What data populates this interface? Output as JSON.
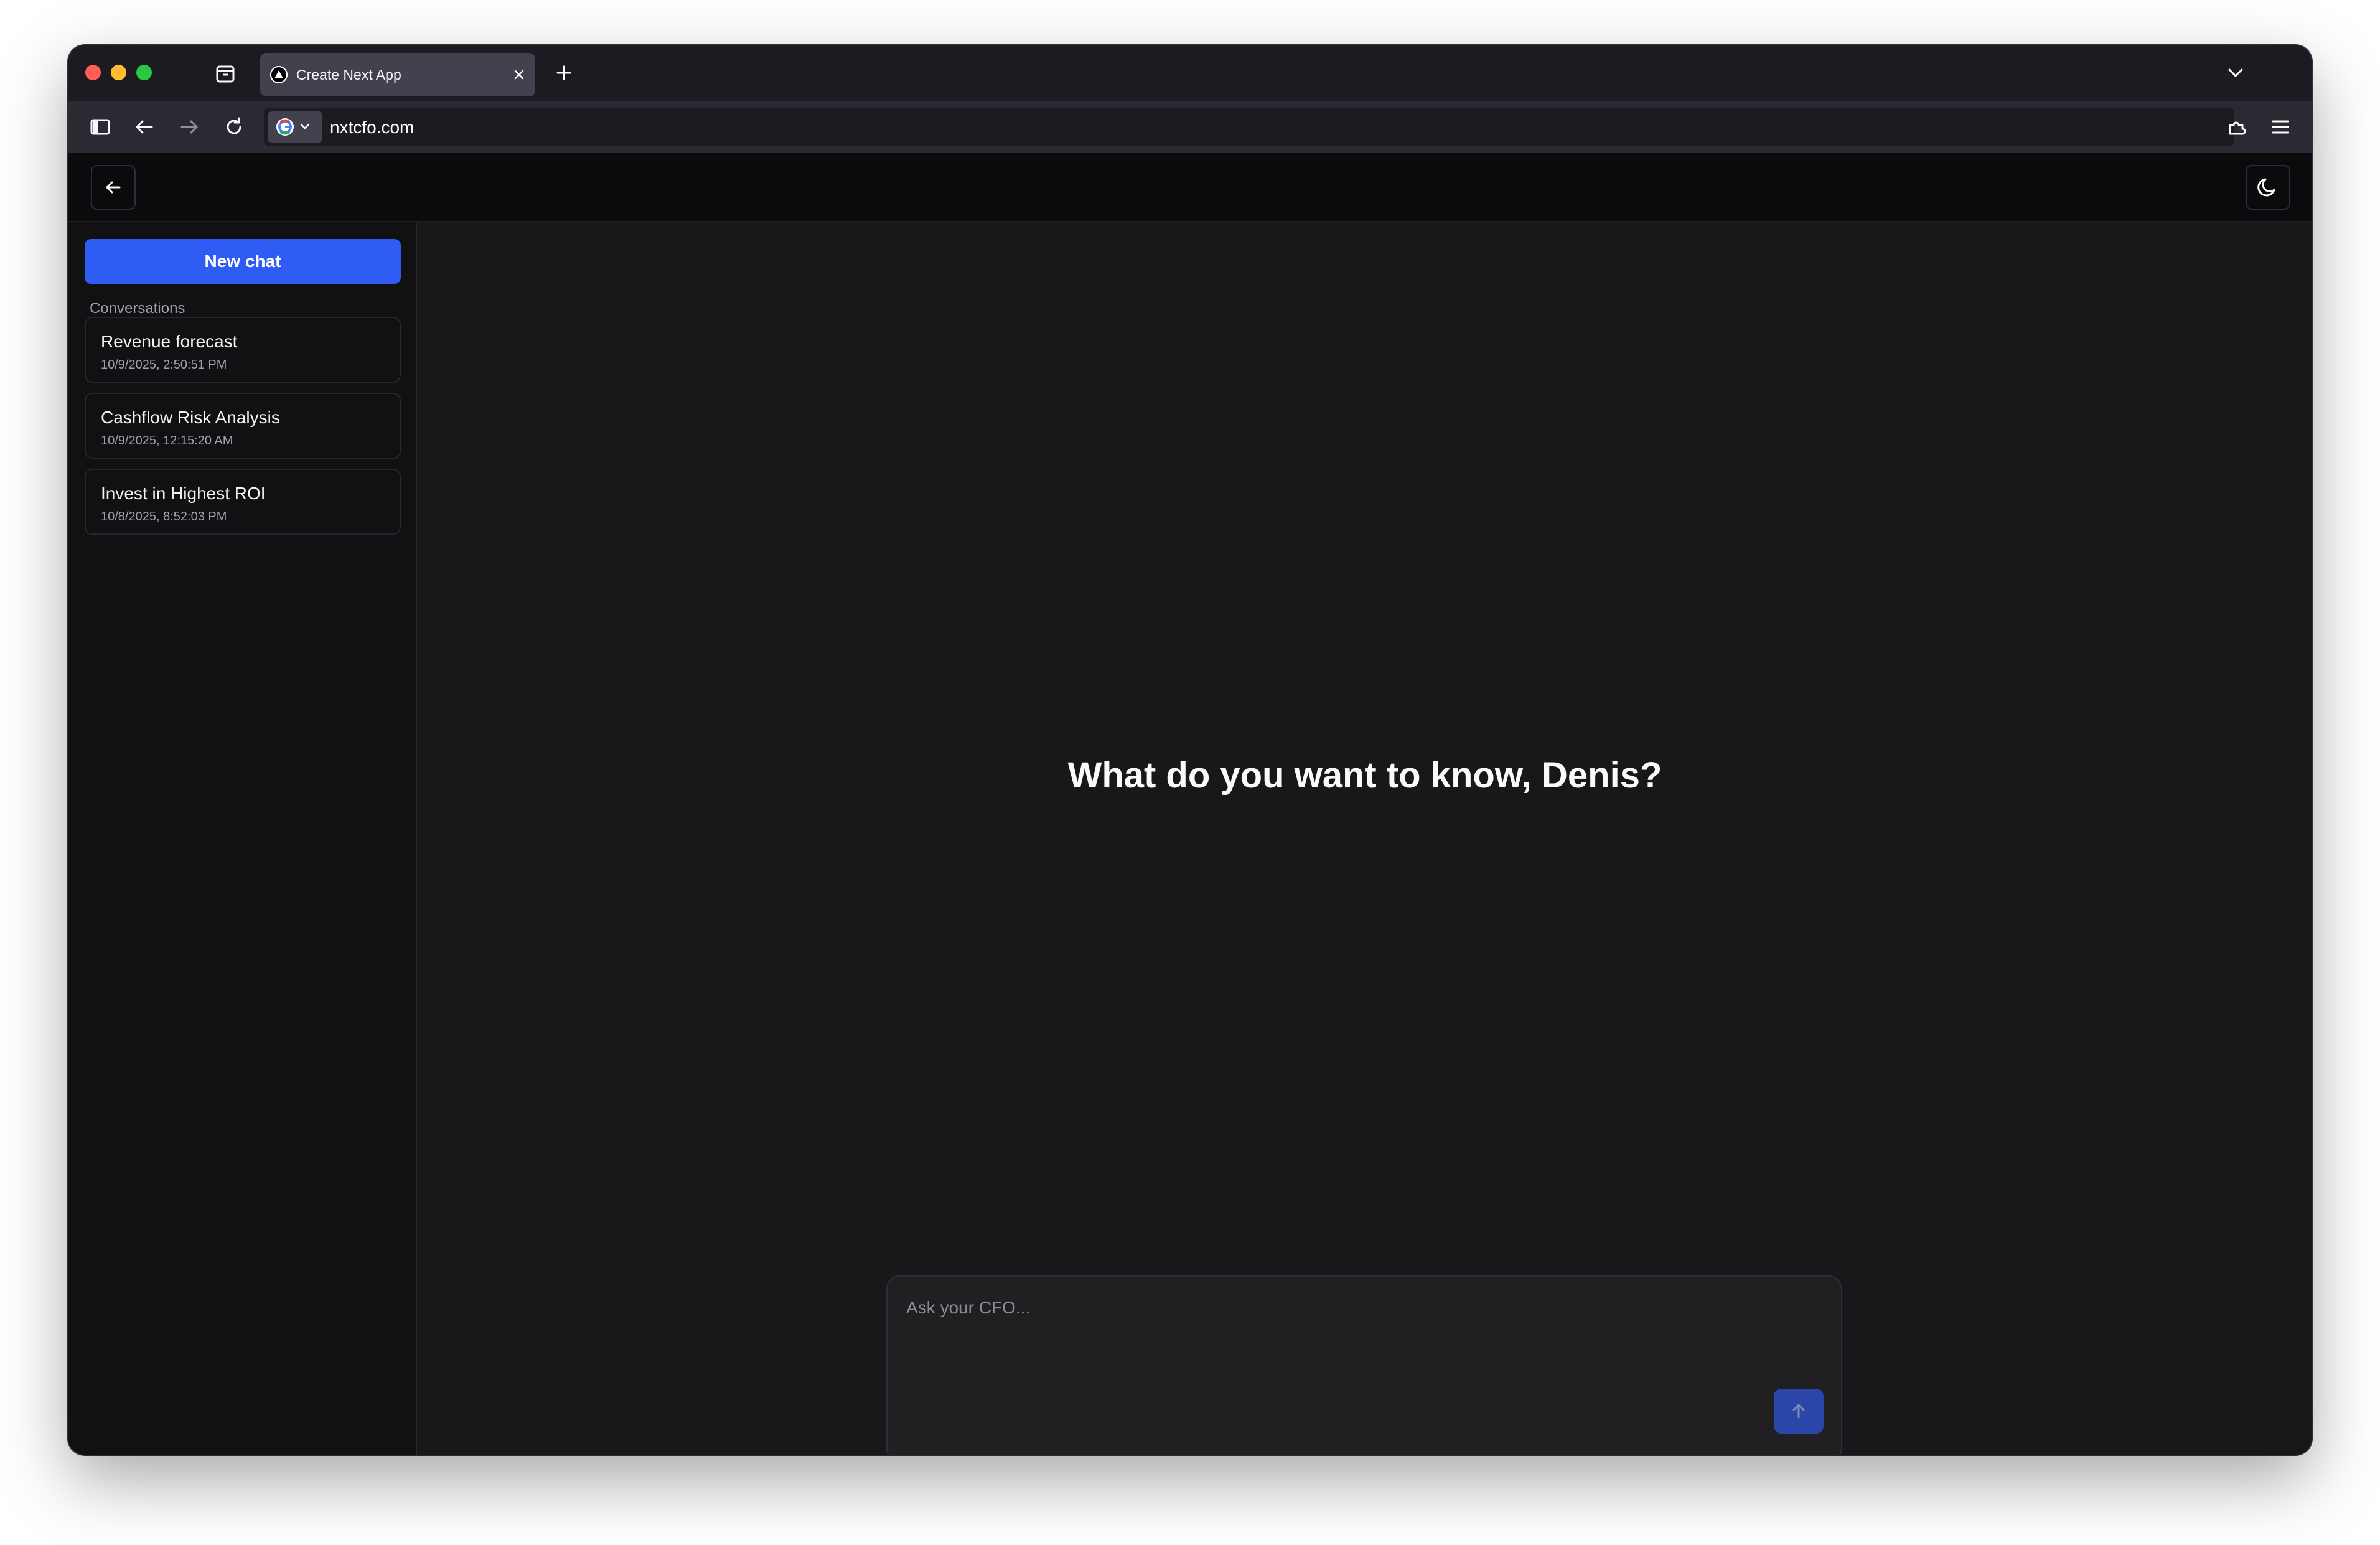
{
  "browser": {
    "tab_title": "Create Next App",
    "url": "nxtcfo.com"
  },
  "sidebar": {
    "new_chat_label": "New chat",
    "section_label": "Conversations",
    "conversations": [
      {
        "title": "Revenue forecast",
        "date": "10/9/2025, 2:50:51 PM"
      },
      {
        "title": "Cashflow Risk Analysis",
        "date": "10/9/2025, 12:15:20 AM"
      },
      {
        "title": "Invest in Highest ROI",
        "date": "10/8/2025, 8:52:03 PM"
      }
    ]
  },
  "main": {
    "greeting": "What do you want to know, Denis?",
    "composer_placeholder": "Ask your CFO..."
  },
  "colors": {
    "accent": "#2f5cf5",
    "send_button": "#2a46a8",
    "background": "#18181b",
    "sidebar": "#111114"
  },
  "icons": [
    "tab-overview-icon",
    "triangle-logo-icon",
    "close-icon",
    "plus-icon",
    "chevron-down-icon",
    "sidebar-toggle-icon",
    "arrow-left-icon",
    "arrow-right-icon",
    "reload-icon",
    "google-icon",
    "extensions-icon",
    "hamburger-menu-icon",
    "moon-icon",
    "arrow-up-icon"
  ]
}
